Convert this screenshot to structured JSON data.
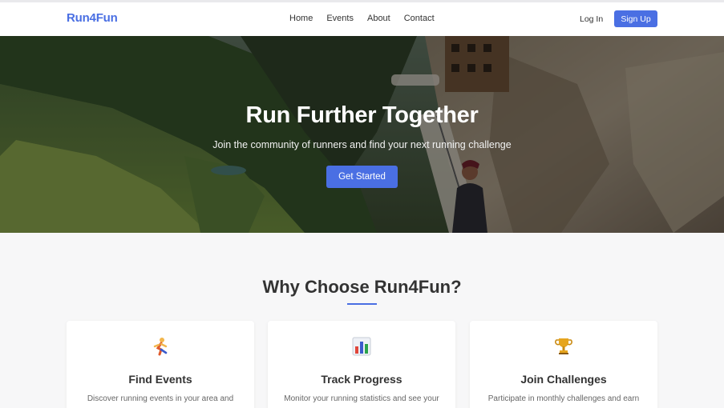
{
  "brand": {
    "name": "Run4Fun",
    "accent": "#4a6fe3"
  },
  "nav": {
    "links": [
      {
        "label": "Home"
      },
      {
        "label": "Events"
      },
      {
        "label": "About"
      },
      {
        "label": "Contact"
      }
    ],
    "login_label": "Log In",
    "signup_label": "Sign Up"
  },
  "hero": {
    "title": "Run Further Together",
    "subtitle": "Join the community of runners and find your next running challenge",
    "cta_label": "Get Started"
  },
  "features": {
    "title": "Why Choose Run4Fun?",
    "cards": [
      {
        "icon": "runner-icon",
        "title": "Find Events",
        "text": "Discover running events in your area and"
      },
      {
        "icon": "bar-chart-icon",
        "title": "Track Progress",
        "text": "Monitor your running statistics and see your"
      },
      {
        "icon": "trophy-icon",
        "title": "Join Challenges",
        "text": "Participate in monthly challenges and earn"
      }
    ]
  }
}
